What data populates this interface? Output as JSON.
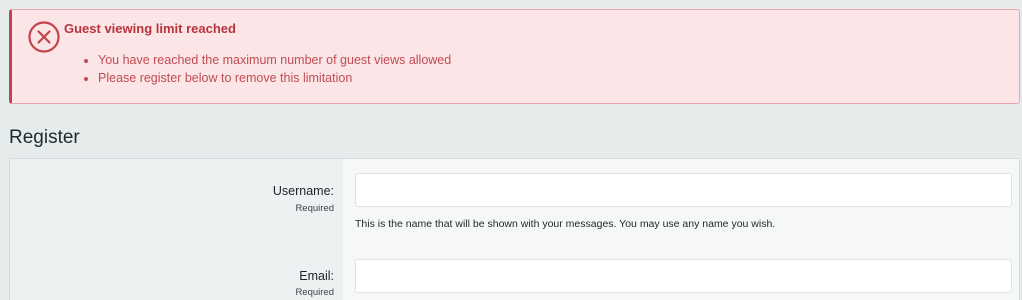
{
  "alert": {
    "icon": "error-circle-x-icon",
    "title": "Guest viewing limit reached",
    "items": [
      "You have reached the maximum number of guest views allowed",
      "Please register below to remove this limitation"
    ],
    "colors": {
      "background": "#fbe5e6",
      "accent": "#c3434b",
      "text": "#b8343c"
    }
  },
  "page": {
    "title": "Register"
  },
  "form": {
    "username": {
      "label": "Username:",
      "hint": "Required",
      "value": "",
      "explain": "This is the name that will be shown with your messages. You may use any name you wish."
    },
    "email": {
      "label": "Email:",
      "hint": "Required",
      "value": ""
    }
  }
}
